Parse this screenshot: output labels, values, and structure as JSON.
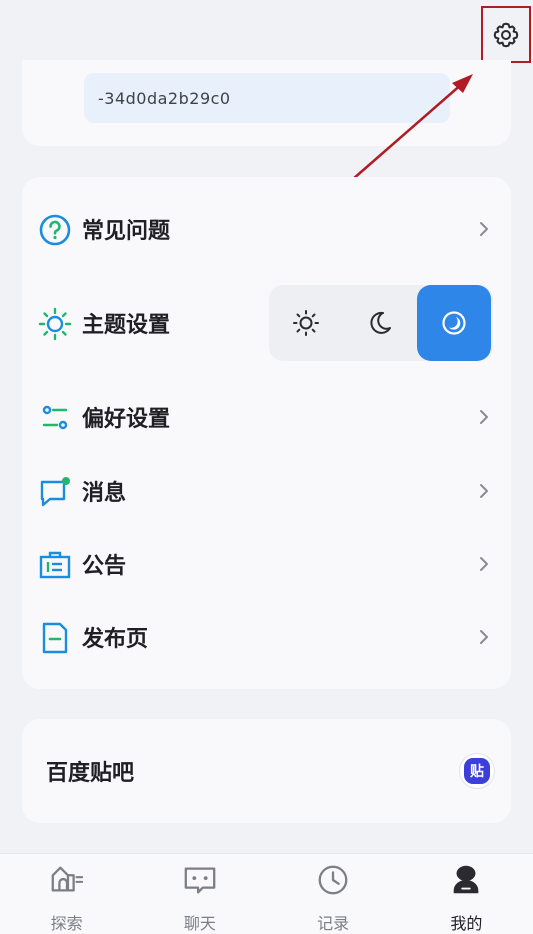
{
  "header": {
    "settings_icon": "gear-icon"
  },
  "account": {
    "id_text": "-34d0da2b29c0"
  },
  "menu": {
    "items": [
      {
        "key": "faq",
        "label": "常见问题",
        "icon": "help-circle-icon",
        "color": "#1a8de0"
      },
      {
        "key": "theme",
        "label": "主题设置",
        "icon": "sun-icon",
        "color": "#1db86c"
      },
      {
        "key": "prefs",
        "label": "偏好设置",
        "icon": "sliders-icon",
        "color": "#1a8de0"
      },
      {
        "key": "messages",
        "label": "消息",
        "icon": "message-icon",
        "color": "#1a8de0",
        "badge_color": "#1db86c"
      },
      {
        "key": "notice",
        "label": "公告",
        "icon": "announcement-icon",
        "color": "#1a8de0"
      },
      {
        "key": "publish",
        "label": "发布页",
        "icon": "document-icon",
        "color": "#1a8de0"
      }
    ],
    "theme_options": [
      {
        "name": "light",
        "icon": "sun-outline-icon",
        "selected": false
      },
      {
        "name": "dark",
        "icon": "moon-icon",
        "selected": false
      },
      {
        "name": "auto",
        "icon": "moon-circle-icon",
        "selected": true
      }
    ]
  },
  "baidu": {
    "label": "百度贴吧",
    "logo_text": "贴"
  },
  "tabbar": {
    "tabs": [
      {
        "label": "探索",
        "icon": "explore-icon",
        "active": false
      },
      {
        "label": "聊天",
        "icon": "chat-icon",
        "active": false
      },
      {
        "label": "记录",
        "icon": "clock-icon",
        "active": false
      },
      {
        "label": "我的",
        "icon": "user-icon",
        "active": true
      }
    ]
  },
  "colors": {
    "accent": "#2e86e8",
    "annotation_red": "#b11b24"
  }
}
